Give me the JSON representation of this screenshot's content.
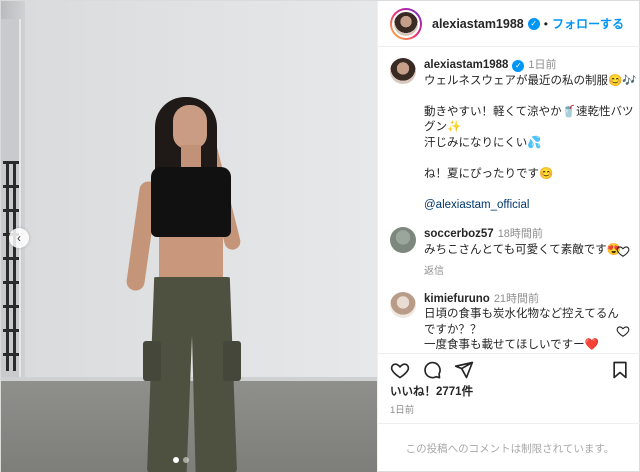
{
  "post": {
    "username": "alexiastam1988",
    "separator": "•",
    "follow_label": "フォローする",
    "verified_icon": "verified-badge-icon"
  },
  "caption": {
    "username": "alexiastam1988",
    "time": "1日前",
    "lines": [
      "ウェルネスウェアが最近の私の制服😊🎶",
      "",
      "動きやすい！軽くて涼やか🥤速乾性バツ",
      "グン✨",
      "汗じみになりにくい💦",
      "",
      "ね！夏にぴったりです😊",
      "",
      "@alexiastam_official"
    ]
  },
  "comments": [
    {
      "username": "soccerboz57",
      "time": "18時間前",
      "lines": [
        "みちこさんとても可愛くて素敵です😍"
      ],
      "reply_label": "返信"
    },
    {
      "username": "kimiefuruno",
      "time": "21時間前",
      "lines": [
        "日頃の食事も炭水化物など控えてるん",
        "ですか？？",
        "一度食事も載せてほしいですー❤️"
      ]
    }
  ],
  "likes_text": "いいね！2771件",
  "post_time": "1日前",
  "comments_disabled_text": "この投稿へのコメントは制限されています。",
  "carousel": {
    "prev_arrow": "‹",
    "total_slides": 2,
    "active_slide": 1
  },
  "colors": {
    "accent": "#0095f6",
    "mention": "#00376b",
    "secondary_text": "#8e8e8e",
    "heart_red": "#ed4956"
  }
}
